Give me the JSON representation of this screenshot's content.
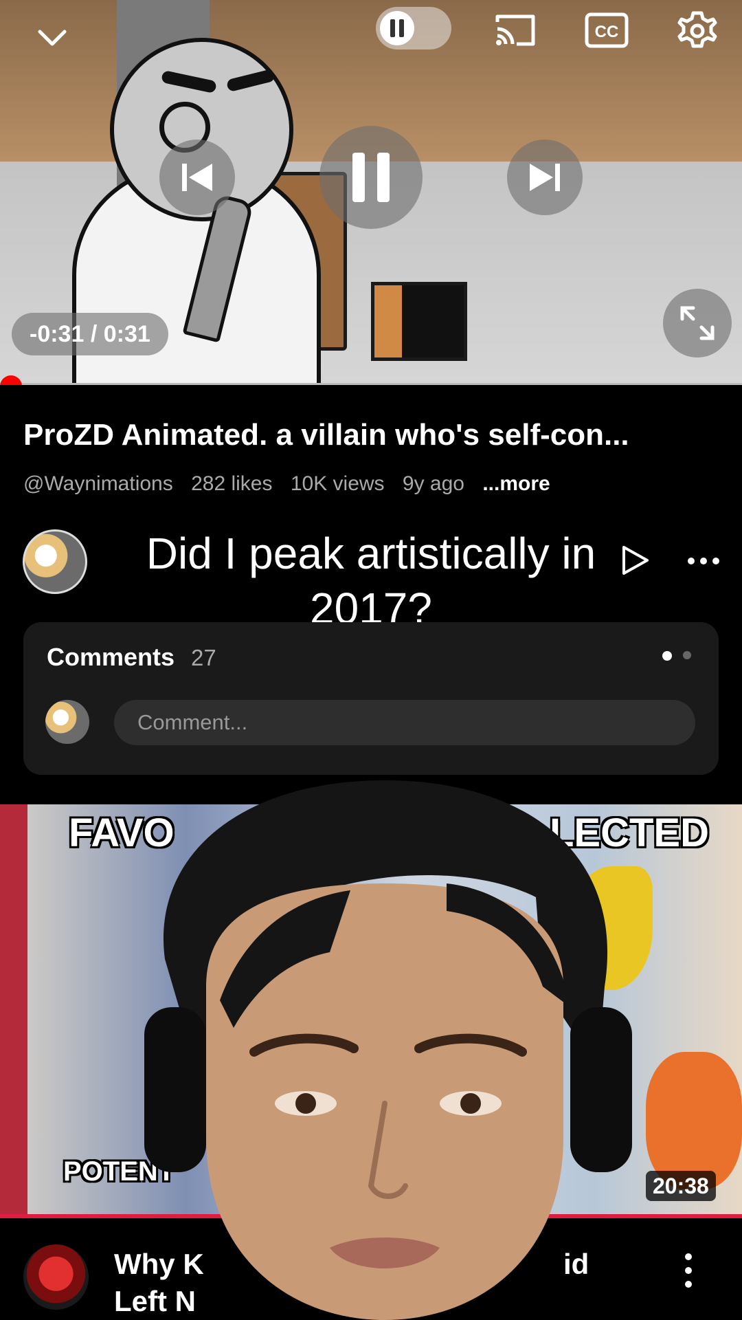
{
  "player": {
    "time_display": "-0:31 / 0:31",
    "progress_fraction": 0.0,
    "icons": [
      "chevron-down-icon",
      "pause-icon",
      "cast-icon",
      "closed-captions-icon",
      "settings-icon",
      "skip-previous-icon",
      "skip-next-icon",
      "fullscreen-icon"
    ],
    "cc_label": "CC"
  },
  "video": {
    "title": "ProZD Animated. a villain who's self-con...",
    "channel": "@Waynimations",
    "likes": "282 likes",
    "views": "10K views",
    "age": "9y ago",
    "more_label": "...more"
  },
  "overlay_caption": "Did I peak artistically in 2017?",
  "comments": {
    "title": "Comments",
    "count": "27",
    "placeholder": "Comment..."
  },
  "next_video": {
    "thumb_text_left": "FAVO",
    "thumb_text_right": "LECTED",
    "thumb_text_bottom": "POTENT",
    "duration": "20:38",
    "title_line1_left": "Why K",
    "title_line1_right": "id",
    "title_line2_left": "Left N",
    "accent_color": "#e01d40"
  },
  "colors": {
    "progress": "#ff0000",
    "background": "#000000",
    "panel": "#1a1a1a"
  }
}
